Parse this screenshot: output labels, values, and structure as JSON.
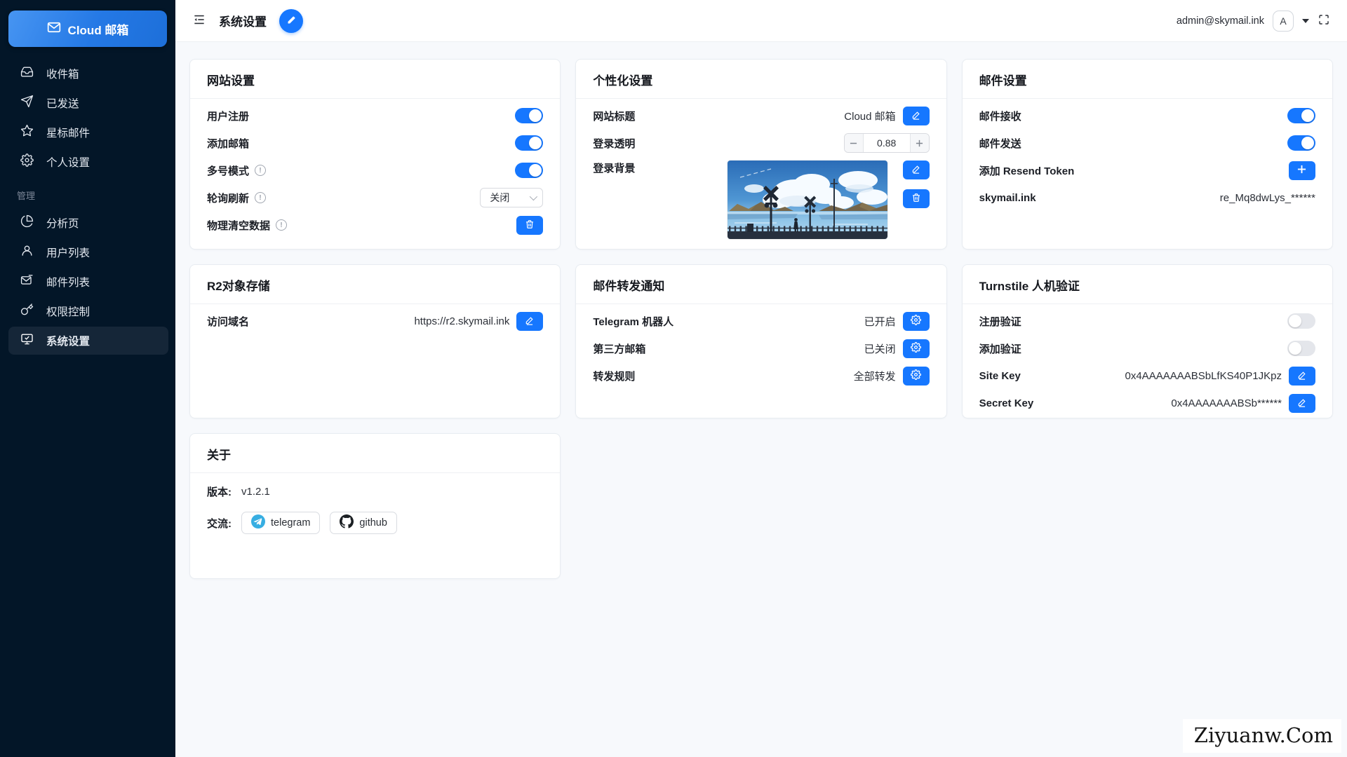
{
  "colors": {
    "primary": "#1677ff",
    "sidebar_bg": "#031628",
    "toggle_off": "#e4e6eb"
  },
  "sidebar": {
    "logo": "Cloud 邮箱",
    "logo_icon": "envelope-icon",
    "menu": [
      {
        "label": "收件箱",
        "icon": "inbox-icon"
      },
      {
        "label": "已发送",
        "icon": "send-icon"
      },
      {
        "label": "星标邮件",
        "icon": "star-icon"
      },
      {
        "label": "个人设置",
        "icon": "gear-icon"
      }
    ],
    "section": "管理",
    "admin_menu": [
      {
        "label": "分析页",
        "icon": "pie-chart-icon"
      },
      {
        "label": "用户列表",
        "icon": "user-icon"
      },
      {
        "label": "邮件列表",
        "icon": "mail-list-icon"
      },
      {
        "label": "权限控制",
        "icon": "key-icon"
      },
      {
        "label": "系统设置",
        "icon": "monitor-check-icon",
        "active": true
      }
    ]
  },
  "header": {
    "title": "系统设置",
    "email": "admin@skymail.ink",
    "avatar": "A"
  },
  "cards": {
    "site": {
      "title": "网站设置",
      "user_register": "用户注册",
      "add_mailbox": "添加邮箱",
      "multi_mode": "多号模式",
      "poll_refresh": "轮询刷新",
      "poll_value": "关闭",
      "purge": "物理清空数据"
    },
    "personal": {
      "title": "个性化设置",
      "site_title_label": "网站标题",
      "site_title_value": "Cloud 邮箱",
      "opacity_label": "登录透明",
      "opacity_value": "0.88",
      "bg_label": "登录背景"
    },
    "mail": {
      "title": "邮件设置",
      "receive": "邮件接收",
      "send": "邮件发送",
      "resend": "添加 Resend Token",
      "domain": "skymail.ink",
      "token": "re_Mq8dwLys_******"
    },
    "r2": {
      "title": "R2对象存储",
      "domain_label": "访问域名",
      "domain_value": "https://r2.skymail.ink"
    },
    "forward": {
      "title": "邮件转发通知",
      "telegram_label": "Telegram 机器人",
      "telegram_status": "已开启",
      "third_label": "第三方邮箱",
      "third_status": "已关闭",
      "rule_label": "转发规则",
      "rule_status": "全部转发"
    },
    "turnstile": {
      "title": "Turnstile 人机验证",
      "register_label": "注册验证",
      "add_label": "添加验证",
      "site_key_label": "Site Key",
      "site_key_value": "0x4AAAAAAABSbLfKS40P1JKpz",
      "secret_key_label": "Secret Key",
      "secret_key_value": "0x4AAAAAAABSb******"
    },
    "about": {
      "title": "关于",
      "version_label": "版本:",
      "version_value": "v1.2.1",
      "contact_label": "交流:",
      "telegram": "telegram",
      "github": "github"
    }
  },
  "watermark": "Ziyuanw.Com"
}
